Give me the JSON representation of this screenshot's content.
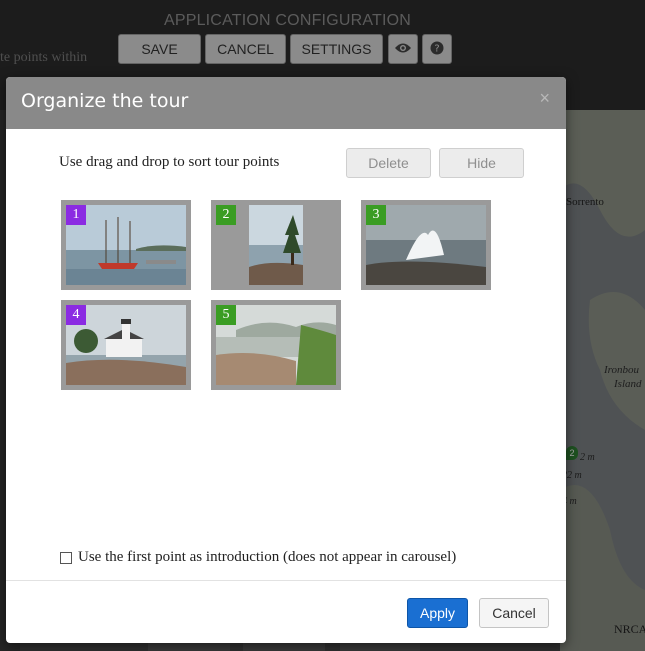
{
  "app": {
    "title": "APPLICATION CONFIGURATION",
    "toolbar": {
      "save_label": "SAVE",
      "cancel_label": "CANCEL",
      "settings_label": "SETTINGS",
      "preview_icon": "eye-icon",
      "help_icon": "help-icon"
    },
    "background_text": "te points within"
  },
  "map": {
    "labels": {
      "sorrento": "Sorrento",
      "ironbound": "Ironbou",
      "island": "Island",
      "nrca": "NRCA"
    },
    "distances": [
      "2 m",
      "22 m",
      "4 m"
    ],
    "marker_number": "2"
  },
  "modal": {
    "title": "Organize the tour",
    "close_icon": "close-icon",
    "instructions": "Use drag and drop to sort tour points",
    "delete_label": "Delete",
    "hide_label": "Hide",
    "tour_points": [
      {
        "number": "1",
        "color": "#8b2be2"
      },
      {
        "number": "2",
        "color": "#3a9d23"
      },
      {
        "number": "3",
        "color": "#3a9d23"
      },
      {
        "number": "4",
        "color": "#8b2be2"
      },
      {
        "number": "5",
        "color": "#3a9d23"
      }
    ],
    "intro_checkbox_label": "Use the first point as introduction (does not appear in carousel)",
    "intro_checked": false,
    "apply_label": "Apply",
    "cancel_label": "Cancel"
  },
  "colors": {
    "primary": "#1a6fd2",
    "header": "#898989"
  }
}
